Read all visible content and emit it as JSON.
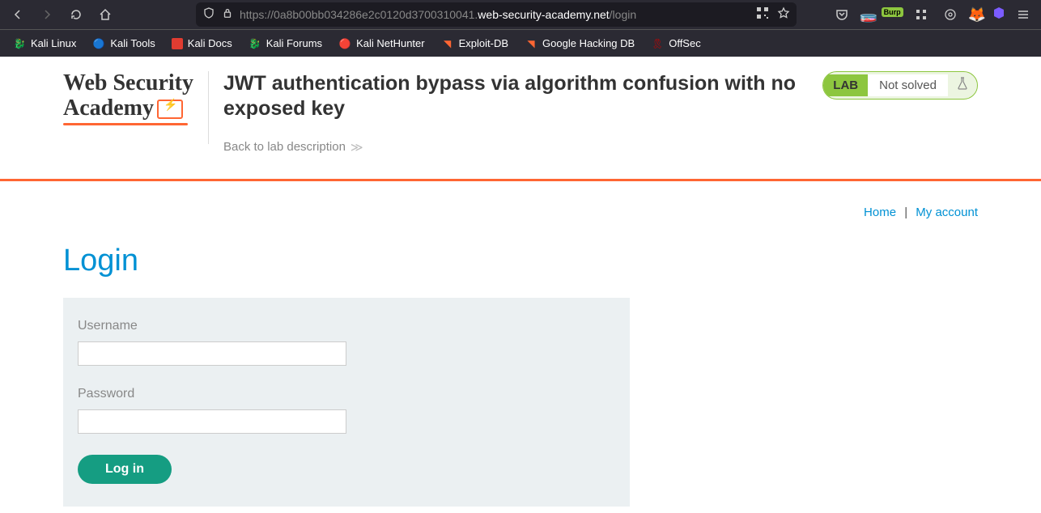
{
  "browser": {
    "url_prefix": "https://",
    "url_sub": "0a8b00bb034286e2c0120d3700310041.",
    "url_domain": "web-security-academy.net",
    "url_path": "/login",
    "burp_label": "Burp"
  },
  "bookmarks": [
    {
      "label": "Kali Linux"
    },
    {
      "label": "Kali Tools"
    },
    {
      "label": "Kali Docs"
    },
    {
      "label": "Kali Forums"
    },
    {
      "label": "Kali NetHunter"
    },
    {
      "label": "Exploit-DB"
    },
    {
      "label": "Google Hacking DB"
    },
    {
      "label": "OffSec"
    }
  ],
  "logo": {
    "line1": "Web Security",
    "line2": "Academy"
  },
  "lab": {
    "title": "JWT authentication bypass via algorithm confusion with no exposed key",
    "back_label": "Back to lab description",
    "badge": "LAB",
    "status": "Not solved"
  },
  "nav": {
    "home": "Home",
    "sep": "|",
    "account": "My account"
  },
  "page": {
    "heading": "Login"
  },
  "form": {
    "username_label": "Username",
    "password_label": "Password",
    "submit_label": "Log in"
  }
}
